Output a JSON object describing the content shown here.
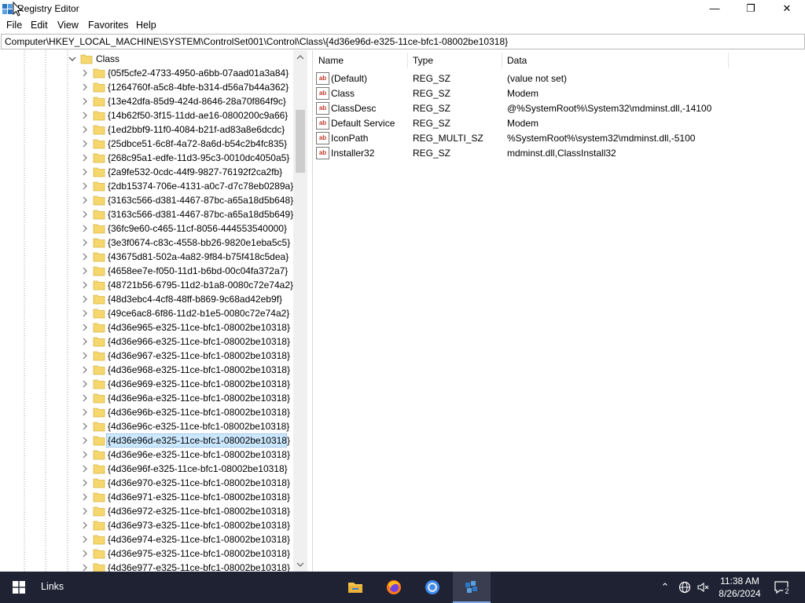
{
  "window": {
    "title": "Registry Editor",
    "minimize_glyph": "—",
    "maximize_glyph": "❐",
    "close_glyph": "✕"
  },
  "menu": [
    "File",
    "Edit",
    "View",
    "Favorites",
    "Help"
  ],
  "address": "Computer\\HKEY_LOCAL_MACHINE\\SYSTEM\\ControlSet001\\Control\\Class\\{4d36e96d-e325-11ce-bfc1-08002be10318}",
  "tree": {
    "parent": "Class",
    "selected_index": 26,
    "items": [
      "{05f5cfe2-4733-4950-a6bb-07aad01a3a84}",
      "{1264760f-a5c8-4bfe-b314-d56a7b44a362}",
      "{13e42dfa-85d9-424d-8646-28a70f864f9c}",
      "{14b62f50-3f15-11dd-ae16-0800200c9a66}",
      "{1ed2bbf9-11f0-4084-b21f-ad83a8e6dcdc}",
      "{25dbce51-6c8f-4a72-8a6d-b54c2b4fc835}",
      "{268c95a1-edfe-11d3-95c3-0010dc4050a5}",
      "{2a9fe532-0cdc-44f9-9827-76192f2ca2fb}",
      "{2db15374-706e-4131-a0c7-d7c78eb0289a}",
      "{3163c566-d381-4467-87bc-a65a18d5b648}",
      "{3163c566-d381-4467-87bc-a65a18d5b649}",
      "{36fc9e60-c465-11cf-8056-444553540000}",
      "{3e3f0674-c83c-4558-bb26-9820e1eba5c5}",
      "{43675d81-502a-4a82-9f84-b75f418c5dea}",
      "{4658ee7e-f050-11d1-b6bd-00c04fa372a7}",
      "{48721b56-6795-11d2-b1a8-0080c72e74a2}",
      "{48d3ebc4-4cf8-48ff-b869-9c68ad42eb9f}",
      "{49ce6ac8-6f86-11d2-b1e5-0080c72e74a2}",
      "{4d36e965-e325-11ce-bfc1-08002be10318}",
      "{4d36e966-e325-11ce-bfc1-08002be10318}",
      "{4d36e967-e325-11ce-bfc1-08002be10318}",
      "{4d36e968-e325-11ce-bfc1-08002be10318}",
      "{4d36e969-e325-11ce-bfc1-08002be10318}",
      "{4d36e96a-e325-11ce-bfc1-08002be10318}",
      "{4d36e96b-e325-11ce-bfc1-08002be10318}",
      "{4d36e96c-e325-11ce-bfc1-08002be10318}",
      "{4d36e96d-e325-11ce-bfc1-08002be10318}",
      "{4d36e96e-e325-11ce-bfc1-08002be10318}",
      "{4d36e96f-e325-11ce-bfc1-08002be10318}",
      "{4d36e970-e325-11ce-bfc1-08002be10318}",
      "{4d36e971-e325-11ce-bfc1-08002be10318}",
      "{4d36e972-e325-11ce-bfc1-08002be10318}",
      "{4d36e973-e325-11ce-bfc1-08002be10318}",
      "{4d36e974-e325-11ce-bfc1-08002be10318}",
      "{4d36e975-e325-11ce-bfc1-08002be10318}",
      "{4d36e977-e325-11ce-bfc1-08002be10318}"
    ]
  },
  "values": {
    "columns": [
      "Name",
      "Type",
      "Data"
    ],
    "icon_glyph": "ab",
    "rows": [
      {
        "name": "(Default)",
        "type": "REG_SZ",
        "data": "(value not set)"
      },
      {
        "name": "Class",
        "type": "REG_SZ",
        "data": "Modem"
      },
      {
        "name": "ClassDesc",
        "type": "REG_SZ",
        "data": "@%SystemRoot%\\System32\\mdminst.dll,-14100"
      },
      {
        "name": "Default Service",
        "type": "REG_SZ",
        "data": "Modem"
      },
      {
        "name": "IconPath",
        "type": "REG_MULTI_SZ",
        "data": "%SystemRoot%\\system32\\mdminst.dll,-5100"
      },
      {
        "name": "Installer32",
        "type": "REG_SZ",
        "data": "mdminst.dll,ClassInstall32"
      }
    ]
  },
  "taskbar": {
    "links_label": "Links",
    "apps": [
      "file-explorer",
      "firefox",
      "chrome",
      "registry-editor"
    ],
    "active_app": "registry-editor",
    "time": "11:38 AM",
    "date": "8/26/2024",
    "notification_count": "2"
  },
  "colors": {
    "selection": "#cce8ff",
    "taskbar": "#1f2233",
    "folder": "#f5d76e"
  }
}
